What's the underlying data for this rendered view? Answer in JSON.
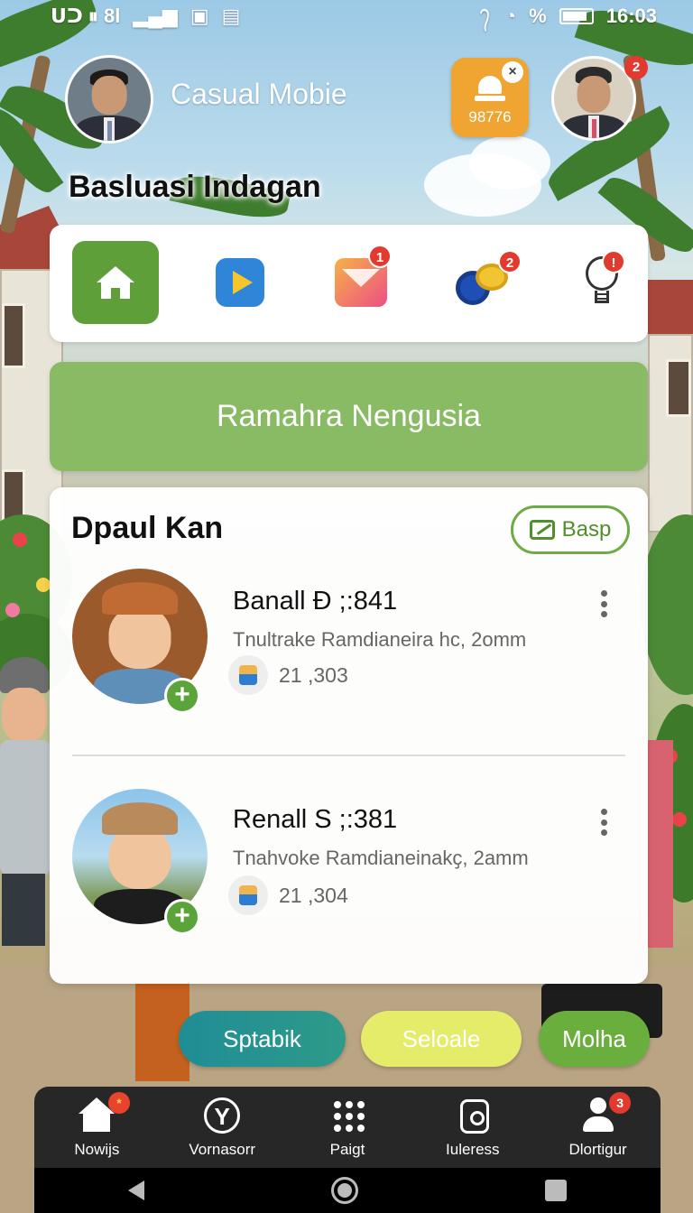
{
  "status_bar": {
    "left_icons": [
      "sim-icon",
      "signal-icon",
      "photo-icon",
      "screenshot-icon"
    ],
    "left_text": "ᑌᑐ ⏸ 8l",
    "right_text": "%",
    "time": "16:03"
  },
  "header": {
    "app_title": "Casual Mobie",
    "notification_value": "98776",
    "notification_icon": "siren-icon",
    "profile_badge": "2",
    "heading": "Basluasi Indagan"
  },
  "quick_icons": [
    {
      "name": "home",
      "icon": "home-icon",
      "badge": ""
    },
    {
      "name": "play-store",
      "icon": "play-icon",
      "badge": ""
    },
    {
      "name": "mail",
      "icon": "mail-icon",
      "badge": "1"
    },
    {
      "name": "coins",
      "icon": "coins-icon",
      "badge": "2"
    },
    {
      "name": "idea",
      "icon": "lightbulb-icon",
      "badge": "!"
    }
  ],
  "banner": {
    "label": "Ramahra Nengusia"
  },
  "friends": {
    "title": "Dpaul Kan",
    "action_label": "Basp",
    "items": [
      {
        "name": "Banall Ð ;:841",
        "subtitle": "Tnultrake Ramdianeira hc, 2omm",
        "points": "21 ,303"
      },
      {
        "name": "Renall S ;:381",
        "subtitle": "Tnahvoke Ramdianeinakҫ, 2amm",
        "points": "21 ,304"
      }
    ]
  },
  "pills": [
    {
      "label": "Sptabik",
      "color": "#1f8d96"
    },
    {
      "label": "Seloale",
      "color": "#e4ec6a"
    },
    {
      "label": "Molha",
      "color": "#6aae3e"
    }
  ],
  "bottom_nav": [
    {
      "label": "Nowijs",
      "icon": "home-icon",
      "badge": "*"
    },
    {
      "label": "Vornasorr",
      "icon": "tree-icon",
      "badge": ""
    },
    {
      "label": "Paigt",
      "icon": "grid-icon",
      "badge": ""
    },
    {
      "label": "Iuleress",
      "icon": "watch-icon",
      "badge": ""
    },
    {
      "label": "Dlortigur",
      "icon": "person-icon",
      "badge": "3"
    }
  ],
  "colors": {
    "accent_green": "#5e9f3a",
    "banner_green": "#88bb63",
    "badge_red": "#e33a2f",
    "orange": "#f0a431"
  }
}
